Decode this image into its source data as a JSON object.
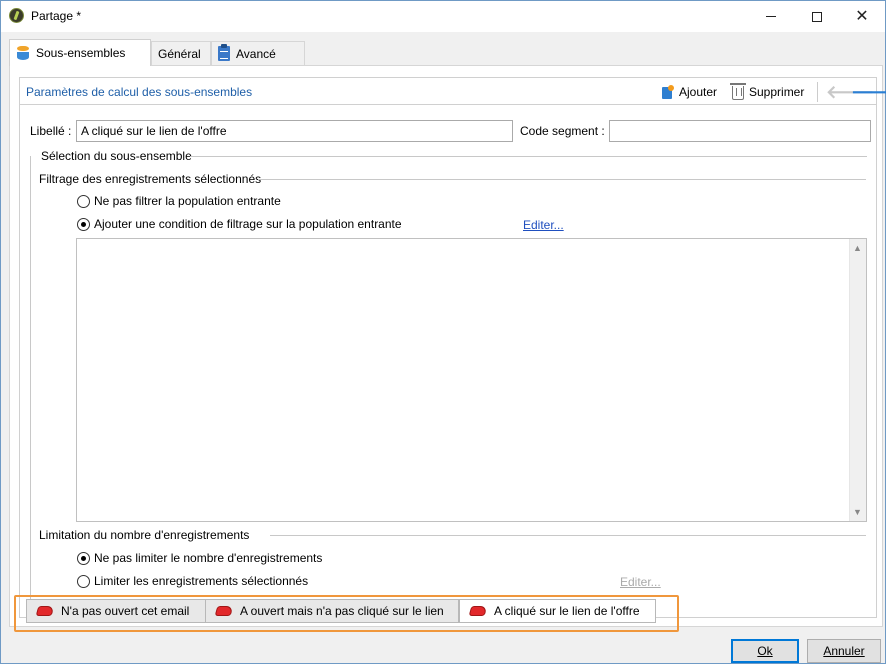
{
  "window": {
    "title": "Partage *"
  },
  "tabs": [
    {
      "label": "Sous-ensembles",
      "icon": "database-icon",
      "active": true
    },
    {
      "label": "Général",
      "active": false
    },
    {
      "label": "Avancé",
      "icon": "clipboard-icon",
      "active": false
    }
  ],
  "header": {
    "title": "Paramètres de calcul des sous-ensembles"
  },
  "toolbar": {
    "add_label": "Ajouter",
    "delete_label": "Supprimer"
  },
  "form": {
    "label_caption": "Libellé :",
    "label_value": "A cliqué sur le lien de l'offre",
    "segment_caption": "Code segment :",
    "segment_value": ""
  },
  "selection": {
    "title": "Sélection du sous-ensemble",
    "filter_title": "Filtrage des enregistrements sélectionnés",
    "option_no_filter": "Ne pas filtrer la population entrante",
    "option_add_condition": "Ajouter une condition de filtrage sur la population entrante",
    "edit_link": "Editer...",
    "selected_option": "option_add_condition"
  },
  "limitation": {
    "title": "Limitation du nombre d'enregistrements",
    "option_no_limit": "Ne pas limiter le nombre d'enregistrements",
    "option_limit": "Limiter les enregistrements sélectionnés",
    "edit_link": "Editer...",
    "selected_option": "option_no_limit"
  },
  "subsets": [
    {
      "label": "N'a pas ouvert cet email",
      "active": false
    },
    {
      "label": "A ouvert mais n'a pas cliqué sur le lien",
      "active": false
    },
    {
      "label": "A cliqué sur le lien de l'offre",
      "active": true
    }
  ],
  "footer": {
    "ok_label": "Ok",
    "cancel_label": "Annuler"
  },
  "colors": {
    "highlight_border": "#f0973c",
    "link": "#1f4fbf",
    "header_title": "#1f5fa8"
  }
}
